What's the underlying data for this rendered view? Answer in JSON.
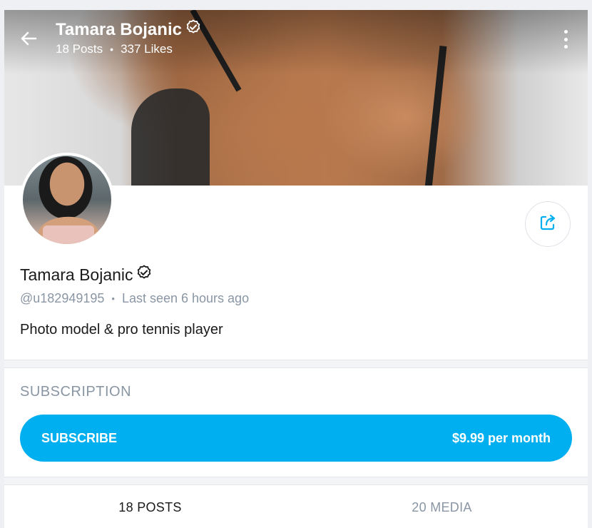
{
  "header": {
    "title": "Tamara Bojanic",
    "posts": "18 Posts",
    "likes": "337 Likes",
    "dot": "•"
  },
  "profile": {
    "name": "Tamara Bojanic",
    "handle": "@u182949195",
    "dot": "•",
    "last_seen": "Last seen 6 hours ago",
    "bio": "Photo model & pro tennis player"
  },
  "subscription": {
    "heading": "SUBSCRIPTION",
    "button_label": "SUBSCRIBE",
    "price": "$9.99 per month"
  },
  "tabs": [
    {
      "label": "18 POSTS",
      "active": true
    },
    {
      "label": "20 MEDIA",
      "active": false
    }
  ],
  "colors": {
    "accent": "#00aff0",
    "muted_text": "#8a96a3",
    "text": "#1a1a1a"
  },
  "icons": [
    "back-arrow-icon",
    "verified-badge-icon",
    "more-vertical-icon",
    "share-icon"
  ]
}
